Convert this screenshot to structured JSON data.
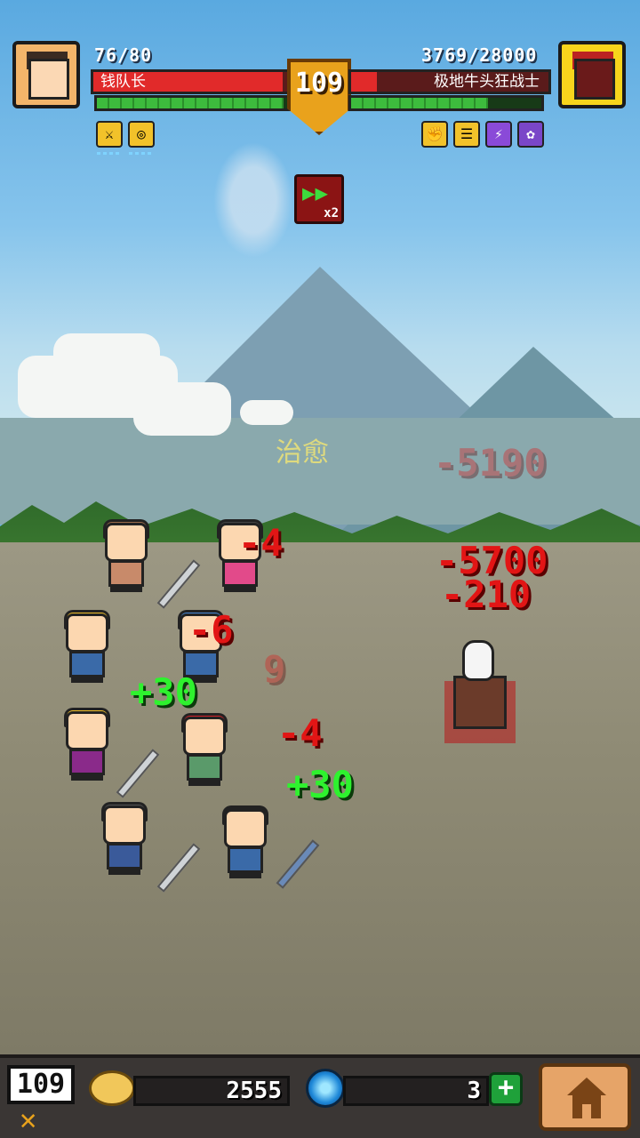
{
  "player": {
    "hp_text": "76/80",
    "name": "钱队长",
    "hp_fraction": 0.95,
    "xp_fraction": 0.97
  },
  "stage": {
    "level": "109",
    "speed": "x2"
  },
  "enemy": {
    "hp_text": "3769/28000",
    "name": "极地牛头狂战士",
    "hp_fraction": 0.13,
    "xp_fraction": 0.72
  },
  "combat_text": {
    "heal_label": "治愈",
    "damage": [
      "-4",
      "-6",
      "-4",
      "-5700",
      "-210"
    ],
    "ghost_damage": [
      "9",
      "-5190"
    ],
    "heals": [
      "+30",
      "+30"
    ]
  },
  "bottom_bar": {
    "level": "109",
    "coins": "2555",
    "gems": "3",
    "plus": "+"
  },
  "colors": {
    "hp_red": "#e12a2a",
    "xp_green": "#3dbb3d",
    "damage_red": "#e21515",
    "heal_green": "#2ef22e"
  }
}
